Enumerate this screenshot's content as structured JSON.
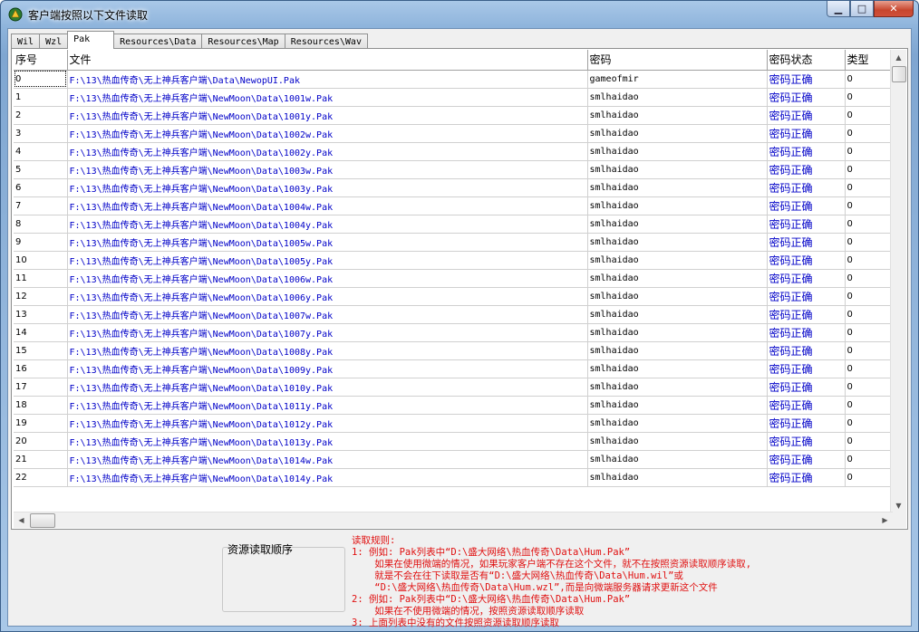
{
  "window": {
    "title": "客户端按照以下文件读取"
  },
  "tabs": [
    {
      "label": "Wil",
      "active": false
    },
    {
      "label": "Wzl",
      "active": false
    },
    {
      "label": "Pak",
      "active": true
    },
    {
      "label": "Resources\\Data",
      "active": false
    },
    {
      "label": "Resources\\Map",
      "active": false
    },
    {
      "label": "Resources\\Wav",
      "active": false
    }
  ],
  "table": {
    "columns": [
      "序号",
      "文件",
      "密码",
      "密码状态",
      "类型"
    ],
    "rows": [
      [
        "0",
        "F:\\13\\热血传奇\\无上神兵客户端\\Data\\NewopUI.Pak",
        "gameofmir",
        "密码正确",
        "0"
      ],
      [
        "1",
        "F:\\13\\热血传奇\\无上神兵客户端\\NewMoon\\Data\\1001w.Pak",
        "smlhaidao",
        "密码正确",
        "0"
      ],
      [
        "2",
        "F:\\13\\热血传奇\\无上神兵客户端\\NewMoon\\Data\\1001y.Pak",
        "smlhaidao",
        "密码正确",
        "0"
      ],
      [
        "3",
        "F:\\13\\热血传奇\\无上神兵客户端\\NewMoon\\Data\\1002w.Pak",
        "smlhaidao",
        "密码正确",
        "0"
      ],
      [
        "4",
        "F:\\13\\热血传奇\\无上神兵客户端\\NewMoon\\Data\\1002y.Pak",
        "smlhaidao",
        "密码正确",
        "0"
      ],
      [
        "5",
        "F:\\13\\热血传奇\\无上神兵客户端\\NewMoon\\Data\\1003w.Pak",
        "smlhaidao",
        "密码正确",
        "0"
      ],
      [
        "6",
        "F:\\13\\热血传奇\\无上神兵客户端\\NewMoon\\Data\\1003y.Pak",
        "smlhaidao",
        "密码正确",
        "0"
      ],
      [
        "7",
        "F:\\13\\热血传奇\\无上神兵客户端\\NewMoon\\Data\\1004w.Pak",
        "smlhaidao",
        "密码正确",
        "0"
      ],
      [
        "8",
        "F:\\13\\热血传奇\\无上神兵客户端\\NewMoon\\Data\\1004y.Pak",
        "smlhaidao",
        "密码正确",
        "0"
      ],
      [
        "9",
        "F:\\13\\热血传奇\\无上神兵客户端\\NewMoon\\Data\\1005w.Pak",
        "smlhaidao",
        "密码正确",
        "0"
      ],
      [
        "10",
        "F:\\13\\热血传奇\\无上神兵客户端\\NewMoon\\Data\\1005y.Pak",
        "smlhaidao",
        "密码正确",
        "0"
      ],
      [
        "11",
        "F:\\13\\热血传奇\\无上神兵客户端\\NewMoon\\Data\\1006w.Pak",
        "smlhaidao",
        "密码正确",
        "0"
      ],
      [
        "12",
        "F:\\13\\热血传奇\\无上神兵客户端\\NewMoon\\Data\\1006y.Pak",
        "smlhaidao",
        "密码正确",
        "0"
      ],
      [
        "13",
        "F:\\13\\热血传奇\\无上神兵客户端\\NewMoon\\Data\\1007w.Pak",
        "smlhaidao",
        "密码正确",
        "0"
      ],
      [
        "14",
        "F:\\13\\热血传奇\\无上神兵客户端\\NewMoon\\Data\\1007y.Pak",
        "smlhaidao",
        "密码正确",
        "0"
      ],
      [
        "15",
        "F:\\13\\热血传奇\\无上神兵客户端\\NewMoon\\Data\\1008y.Pak",
        "smlhaidao",
        "密码正确",
        "0"
      ],
      [
        "16",
        "F:\\13\\热血传奇\\无上神兵客户端\\NewMoon\\Data\\1009y.Pak",
        "smlhaidao",
        "密码正确",
        "0"
      ],
      [
        "17",
        "F:\\13\\热血传奇\\无上神兵客户端\\NewMoon\\Data\\1010y.Pak",
        "smlhaidao",
        "密码正确",
        "0"
      ],
      [
        "18",
        "F:\\13\\热血传奇\\无上神兵客户端\\NewMoon\\Data\\1011y.Pak",
        "smlhaidao",
        "密码正确",
        "0"
      ],
      [
        "19",
        "F:\\13\\热血传奇\\无上神兵客户端\\NewMoon\\Data\\1012y.Pak",
        "smlhaidao",
        "密码正确",
        "0"
      ],
      [
        "20",
        "F:\\13\\热血传奇\\无上神兵客户端\\NewMoon\\Data\\1013y.Pak",
        "smlhaidao",
        "密码正确",
        "0"
      ],
      [
        "21",
        "F:\\13\\热血传奇\\无上神兵客户端\\NewMoon\\Data\\1014w.Pak",
        "smlhaidao",
        "密码正确",
        "0"
      ],
      [
        "22",
        "F:\\13\\热血传奇\\无上神兵客户端\\NewMoon\\Data\\1014y.Pak",
        "smlhaidao",
        "密码正确",
        "0"
      ]
    ]
  },
  "resource_order": {
    "label": "资源读取顺序"
  },
  "rules": {
    "title": "读取规则:",
    "lines": [
      "1: 例如: Pak列表中“D:\\盛大网络\\热血传奇\\Data\\Hum.Pak”",
      "    如果在使用微端的情况，如果玩家客户端不存在这个文件，就不在按照资源读取顺序读取,",
      "    就是不会在往下读取是否有“D:\\盛大网络\\热血传奇\\Data\\Hum.wil”或",
      "    “D:\\盛大网络\\热血传奇\\Data\\Hum.wzl”,而是向微端服务器请求更新这个文件",
      "2: 例如: Pak列表中“D:\\盛大网络\\热血传奇\\Data\\Hum.Pak”",
      "    如果在不使用微端的情况，按照资源读取顺序读取",
      "3: 上面列表中没有的文件按照资源读取顺序读取"
    ]
  }
}
